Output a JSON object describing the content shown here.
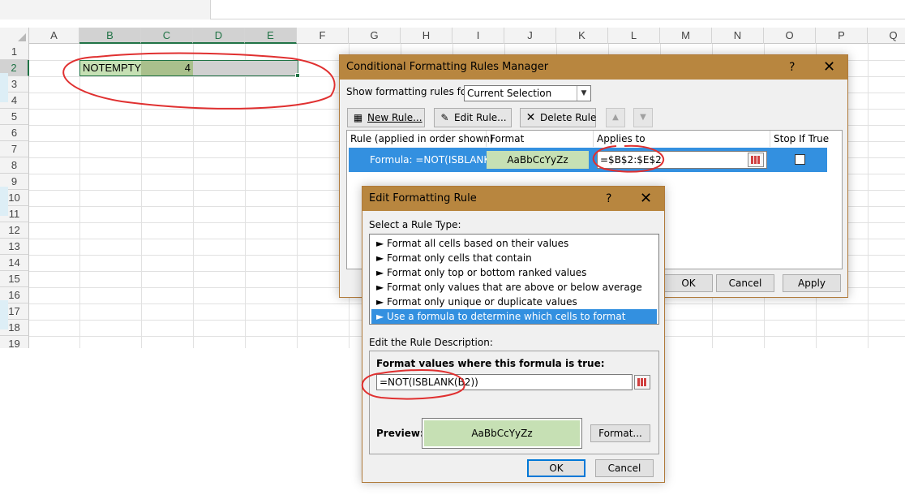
{
  "sheet": {
    "columns": [
      "A",
      "B",
      "C",
      "D",
      "E",
      "F",
      "G",
      "H",
      "I",
      "J",
      "K",
      "L",
      "M",
      "N",
      "O",
      "P",
      "Q"
    ],
    "rows": [
      "1",
      "2",
      "3",
      "4",
      "5",
      "6",
      "7",
      "8",
      "9",
      "10",
      "11",
      "12",
      "13",
      "14",
      "15",
      "16",
      "17",
      "18",
      "19"
    ],
    "cells": {
      "B2": "NOTEMPTY",
      "C2": "4"
    },
    "colors": {
      "selection": "#217346",
      "format_fill": "#c6e0b4"
    }
  },
  "manager": {
    "title": "Conditional Formatting Rules Manager",
    "help": "?",
    "close": "✕",
    "show_label": "Show formatting rules for:",
    "show_value": "Current Selection",
    "new_rule": "New Rule...",
    "edit_rule": "Edit Rule...",
    "delete_rule": "Delete Rule",
    "move_up": "▲",
    "move_down": "▼",
    "headers": {
      "rule": "Rule (applied in order shown)",
      "format": "Format",
      "applies": "Applies to",
      "stop": "Stop If True"
    },
    "rule": {
      "formula": "Formula: =NOT(ISBLANK...",
      "preview": "AaBbCcYyZz",
      "applies_to": "=$B$2:$E$2"
    },
    "ok": "OK",
    "cancel": "Cancel",
    "apply": "Apply"
  },
  "edit": {
    "title": "Edit Formatting Rule",
    "help": "?",
    "close": "✕",
    "select_type_label": "Select a Rule Type:",
    "rule_types": [
      "► Format all cells based on their values",
      "► Format only cells that contain",
      "► Format only top or bottom ranked values",
      "► Format only values that are above or below average",
      "► Format only unique or duplicate values",
      "► Use a formula to determine which cells to format"
    ],
    "desc_label": "Edit the Rule Description:",
    "formula_label": "Format values where this formula is true:",
    "formula": "=NOT(ISBLANK(B2))",
    "preview_label": "Preview:",
    "preview_text": "AaBbCcYyZz",
    "format_button": "Format...",
    "ok": "OK",
    "cancel": "Cancel"
  }
}
